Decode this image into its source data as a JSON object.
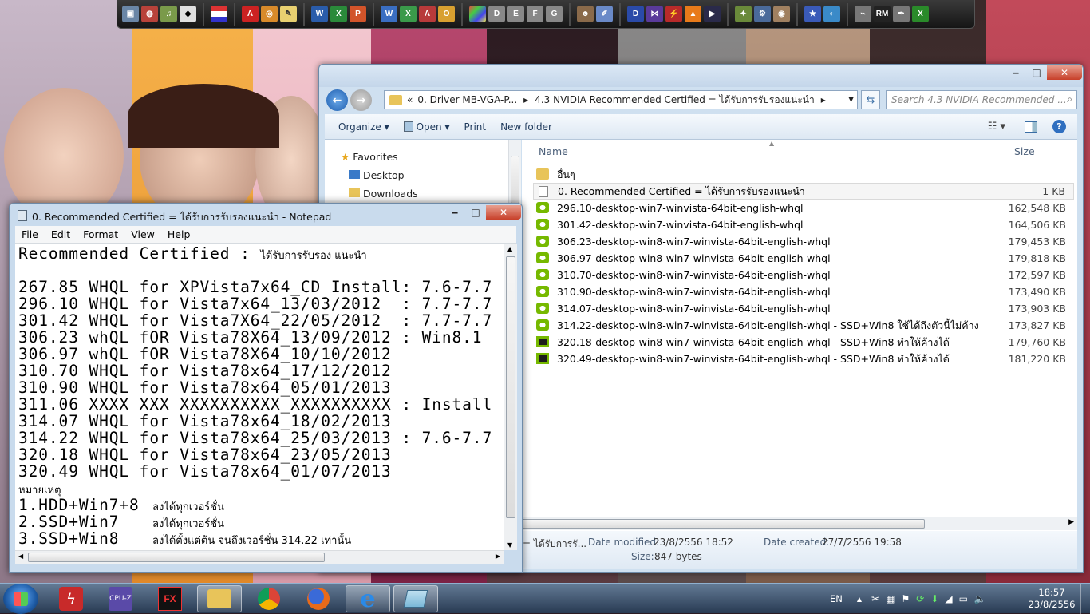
{
  "dock": {
    "icons": [
      "computer-icon",
      "network-icon",
      "media-icon",
      "linux-icon",
      "flag-icon",
      "pdf-icon",
      "camera-icon",
      "notes-icon",
      "word-icon",
      "excel-icon",
      "powerpoint-icon",
      "word2-icon",
      "excel2-icon",
      "access-icon",
      "outlook-icon",
      "windows-icon",
      "drive-d-icon",
      "drive-e-icon",
      "drive-f-icon",
      "drive-g-icon",
      "media-player-icon",
      "paint-icon",
      "daemon-icon",
      "vs-icon",
      "flash-icon",
      "vlc-icon",
      "player-icon",
      "tools-icon",
      "control-icon",
      "disc-icon",
      "star-icon",
      "settings-icon",
      "usb-icon",
      "rm-icon",
      "pen-icon",
      "x-icon"
    ]
  },
  "explorer": {
    "window_controls": {
      "minimize": "‒",
      "maximize": "□",
      "close": "✕"
    },
    "address": {
      "overflow": "«",
      "crumb1": "0. Driver MB-VGA-P...",
      "crumb2": "4.3 NVIDIA Recommended Certified  = ได้รับการรับรองแนะนำ",
      "sep": "▸"
    },
    "search_placeholder": "Search 4.3 NVIDIA Recommended ...",
    "toolbar": {
      "organize": "Organize",
      "open": "Open",
      "print": "Print",
      "new_folder": "New folder"
    },
    "nav": {
      "favorites": "Favorites",
      "desktop": "Desktop",
      "downloads": "Downloads"
    },
    "columns": {
      "name": "Name",
      "size": "Size"
    },
    "files": [
      {
        "name": "อื่นๆ",
        "size": "",
        "type": "folder"
      },
      {
        "name": "0. Recommended Certified  = ได้รับการรับรองแนะนำ",
        "size": "1 KB",
        "type": "text"
      },
      {
        "name": "296.10-desktop-win7-winvista-64bit-english-whql",
        "size": "162,548 KB",
        "type": "nvidia"
      },
      {
        "name": "301.42-desktop-win7-winvista-64bit-english-whql",
        "size": "164,506 KB",
        "type": "nvidia"
      },
      {
        "name": "306.23-desktop-win8-win7-winvista-64bit-english-whql",
        "size": "179,453 KB",
        "type": "nvidia"
      },
      {
        "name": "306.97-desktop-win8-win7-winvista-64bit-english-whql",
        "size": "179,818 KB",
        "type": "nvidia"
      },
      {
        "name": "310.70-desktop-win8-win7-winvista-64bit-english-whql",
        "size": "172,597 KB",
        "type": "nvidia"
      },
      {
        "name": "310.90-desktop-win8-win7-winvista-64bit-english-whql",
        "size": "173,490 KB",
        "type": "nvidia"
      },
      {
        "name": "314.07-desktop-win8-win7-winvista-64bit-english-whql",
        "size": "173,903 KB",
        "type": "nvidia"
      },
      {
        "name": "314.22-desktop-win8-win7-winvista-64bit-english-whql - SSD+Win8 ใช้ได้ถึงตัวนี้ไม่ค้าง",
        "size": "173,827 KB",
        "type": "nvidia"
      },
      {
        "name": "320.18-desktop-win8-win7-winvista-64bit-english-whql - SSD+Win8 ทำให้ค้างได้",
        "size": "179,760 KB",
        "type": "nvidia-dark"
      },
      {
        "name": "320.49-desktop-win8-win7-winvista-64bit-english-whql - SSD+Win8 ทำให้ค้างได้",
        "size": "181,220 KB",
        "type": "nvidia-dark"
      }
    ],
    "details": {
      "name": "= ได้รับการรั...",
      "modified_label": "Date modified:",
      "modified": "23/8/2556 18:52",
      "created_label": "Date created:",
      "created": "27/7/2556 19:58",
      "size_label": "Size:",
      "size": "847 bytes"
    }
  },
  "notepad": {
    "title": "0. Recommended Certified  = ได้รับการรับรองแนะนำ - Notepad",
    "menu": [
      "File",
      "Edit",
      "Format",
      "View",
      "Help"
    ],
    "heading": {
      "latin": "Recommended Certified : ",
      "thai": "ได้รับการรับรอง แนะนำ"
    },
    "lines": [
      "267.85 WHQL for XPVista7x64_CD Install: 7.6-7.7",
      "296.10 WHQL for Vista7x64_13/03/2012  : 7.7-7.7",
      "301.42 WHQL for Vista7X64_22/05/2012  : 7.7-7.7",
      "306.23 whQL fOR Vista78X64_13/09/2012 : Win8.1",
      "306.97 whQL fOR Vista78X64_10/10/2012",
      "310.70 WHQL for Vista78x64_17/12/2012",
      "310.90 WHQL for Vista78x64_05/01/2013",
      "311.06 XXXX XXX XXXXXXXXXX_XXXXXXXXXX : Install",
      "314.07 WHQL for Vista78x64_18/02/2013",
      "314.22 WHQL for Vista78x64_25/03/2013 : 7.6-7.7",
      "320.18 WHQL for Vista78x64_23/05/2013",
      "320.49 WHQL for Vista78x64_01/07/2013"
    ],
    "note_label": "หมายเหตุ",
    "notes": [
      {
        "item": "1.HDD+Win7+8",
        "text": "ลงได้ทุกเวอร์ชั่น"
      },
      {
        "item": "2.SSD+Win7",
        "text": "ลงได้ทุกเวอร์ชั่น"
      },
      {
        "item": "3.SSD+Win8",
        "text": "ลงได้ตั้งแต่ต้น จนถึงเวอร์ชั่น 314.22 เท่านั้น"
      }
    ]
  },
  "taskbar": {
    "apps": [
      "flash-app-icon",
      "cpuz-icon",
      "amd-fx-icon",
      "file-explorer-icon",
      "chrome-icon",
      "firefox-icon",
      "ie-icon",
      "notepad-icon"
    ],
    "cpuz_label": "CPU-Z",
    "fx_label": "FX",
    "language": "EN",
    "time": "18:57",
    "date": "23/8/2556"
  }
}
